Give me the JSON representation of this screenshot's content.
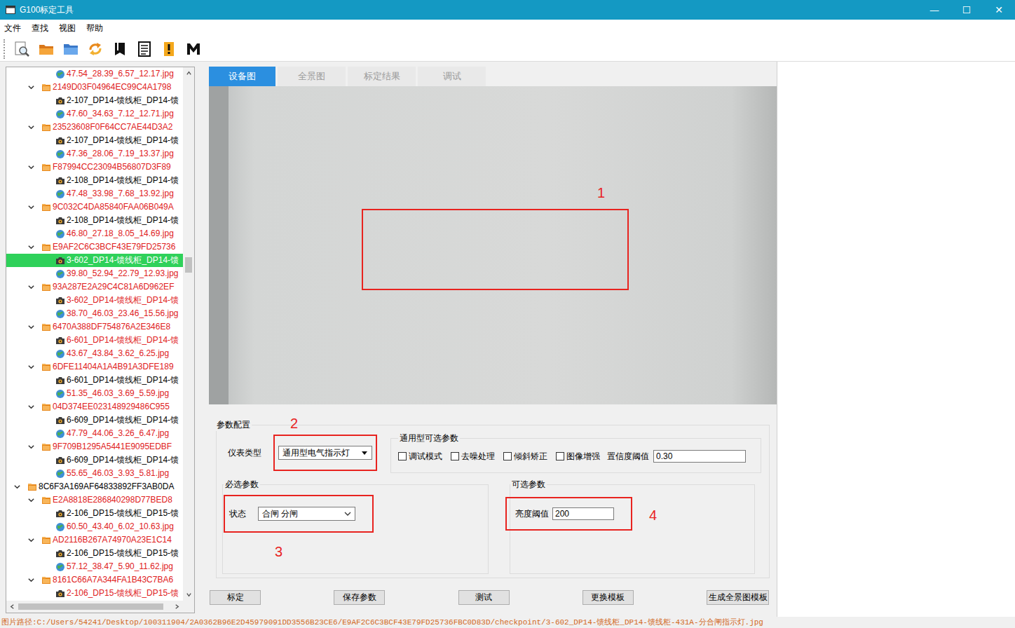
{
  "window": {
    "title": "G100标定工具",
    "controls": [
      "—",
      "☐",
      "✕"
    ]
  },
  "menu": [
    "文件",
    "查找",
    "视图",
    "帮助"
  ],
  "tree": {
    "items": [
      {
        "kind": "globe",
        "level": 2,
        "label": "47.54_28.39_6.57_12.17.jpg",
        "color": "#e0201c",
        "selected": false
      },
      {
        "kind": "folder",
        "level": 1,
        "expanded": true,
        "label": "2149D03F04964EC99C4A1798",
        "color": "#e0201c",
        "selected": false
      },
      {
        "kind": "image",
        "level": 2,
        "label": "2-107_DP14-馈线柜_DP14-馈",
        "color": "#000000",
        "selected": false
      },
      {
        "kind": "globe",
        "level": 2,
        "label": "47.60_34.63_7.12_12.71.jpg",
        "color": "#e0201c",
        "selected": false
      },
      {
        "kind": "folder",
        "level": 1,
        "expanded": true,
        "label": "23523608F0F64CC7AE44D3A2",
        "color": "#e0201c",
        "selected": false
      },
      {
        "kind": "image",
        "level": 2,
        "label": "2-107_DP14-馈线柜_DP14-馈",
        "color": "#000000",
        "selected": false
      },
      {
        "kind": "globe",
        "level": 2,
        "label": "47.36_28.06_7.19_13.37.jpg",
        "color": "#e0201c",
        "selected": false
      },
      {
        "kind": "folder",
        "level": 1,
        "expanded": true,
        "label": "F87994CC23094B56807D3F89",
        "color": "#e0201c",
        "selected": false
      },
      {
        "kind": "image",
        "level": 2,
        "label": "2-108_DP14-馈线柜_DP14-馈",
        "color": "#000000",
        "selected": false
      },
      {
        "kind": "globe",
        "level": 2,
        "label": "47.48_33.98_7.68_13.92.jpg",
        "color": "#e0201c",
        "selected": false
      },
      {
        "kind": "folder",
        "level": 1,
        "expanded": true,
        "label": "9C032C4DA85840FAA06B049A",
        "color": "#e0201c",
        "selected": false
      },
      {
        "kind": "image",
        "level": 2,
        "label": "2-108_DP14-馈线柜_DP14-馈",
        "color": "#000000",
        "selected": false
      },
      {
        "kind": "globe",
        "level": 2,
        "label": "46.80_27.18_8.05_14.69.jpg",
        "color": "#e0201c",
        "selected": false
      },
      {
        "kind": "folder",
        "level": 1,
        "expanded": true,
        "label": "E9AF2C6C3BCF43E79FD25736",
        "color": "#e0201c",
        "selected": false
      },
      {
        "kind": "image",
        "level": 2,
        "label": "3-602_DP14-馈线柜_DP14-馈",
        "color": "#000000",
        "selected": true
      },
      {
        "kind": "globe",
        "level": 2,
        "label": "39.80_52.94_22.79_12.93.jpg",
        "color": "#e0201c",
        "selected": false
      },
      {
        "kind": "folder",
        "level": 1,
        "expanded": true,
        "label": "93A287E2A29C4C81A6D962EF",
        "color": "#e0201c",
        "selected": false
      },
      {
        "kind": "image",
        "level": 2,
        "label": "3-602_DP14-馈线柜_DP14-馈",
        "color": "#e0201c",
        "selected": false
      },
      {
        "kind": "globe",
        "level": 2,
        "label": "38.70_46.03_23.46_15.56.jpg",
        "color": "#e0201c",
        "selected": false
      },
      {
        "kind": "folder",
        "level": 1,
        "expanded": true,
        "label": "6470A388DF754876A2E346E8",
        "color": "#e0201c",
        "selected": false
      },
      {
        "kind": "image",
        "level": 2,
        "label": "6-601_DP14-馈线柜_DP14-馈",
        "color": "#e0201c",
        "selected": false
      },
      {
        "kind": "globe",
        "level": 2,
        "label": "43.67_43.84_3.62_6.25.jpg",
        "color": "#e0201c",
        "selected": false
      },
      {
        "kind": "folder",
        "level": 1,
        "expanded": true,
        "label": "6DFE11404A1A4B91A3DFE189",
        "color": "#e0201c",
        "selected": false
      },
      {
        "kind": "image",
        "level": 2,
        "label": "6-601_DP14-馈线柜_DP14-馈",
        "color": "#000000",
        "selected": false
      },
      {
        "kind": "globe",
        "level": 2,
        "label": "51.35_46.03_3.69_5.59.jpg",
        "color": "#e0201c",
        "selected": false
      },
      {
        "kind": "folder",
        "level": 1,
        "expanded": true,
        "label": "04D374EE023148929486C955",
        "color": "#e0201c",
        "selected": false
      },
      {
        "kind": "image",
        "level": 2,
        "label": "6-609_DP14-馈线柜_DP14-馈",
        "color": "#000000",
        "selected": false
      },
      {
        "kind": "globe",
        "level": 2,
        "label": "47.79_44.06_3.26_6.47.jpg",
        "color": "#e0201c",
        "selected": false
      },
      {
        "kind": "folder",
        "level": 1,
        "expanded": true,
        "label": "9F709B1295A5441E9095EDBF",
        "color": "#e0201c",
        "selected": false
      },
      {
        "kind": "image",
        "level": 2,
        "label": "6-609_DP14-馈线柜_DP14-馈",
        "color": "#000000",
        "selected": false
      },
      {
        "kind": "globe",
        "level": 2,
        "label": "55.65_46.03_3.93_5.81.jpg",
        "color": "#e0201c",
        "selected": false
      },
      {
        "kind": "folder",
        "level": 0,
        "expanded": true,
        "label": "8C6F3A169AF64833892FF3AB0DA",
        "color": "#000000",
        "selected": false
      },
      {
        "kind": "folder",
        "level": 1,
        "expanded": true,
        "label": "E2A8818E286840298D77BED8",
        "color": "#e0201c",
        "selected": false
      },
      {
        "kind": "image",
        "level": 2,
        "label": "2-106_DP15-馈线柜_DP15-馈",
        "color": "#000000",
        "selected": false
      },
      {
        "kind": "globe",
        "level": 2,
        "label": "60.50_43.40_6.02_10.63.jpg",
        "color": "#e0201c",
        "selected": false
      },
      {
        "kind": "folder",
        "level": 1,
        "expanded": true,
        "label": "AD2116B267A74970A23E1C14",
        "color": "#e0201c",
        "selected": false
      },
      {
        "kind": "image",
        "level": 2,
        "label": "2-106_DP15-馈线柜_DP15-馈",
        "color": "#000000",
        "selected": false
      },
      {
        "kind": "globe",
        "level": 2,
        "label": "57.12_38.47_5.90_11.62.jpg",
        "color": "#e0201c",
        "selected": false
      },
      {
        "kind": "folder",
        "level": 1,
        "expanded": true,
        "label": "8161C66A7A344FA1B43C7BA6",
        "color": "#e0201c",
        "selected": false
      },
      {
        "kind": "image",
        "level": 2,
        "label": "2-106_DP15-馈线柜_DP15-馈",
        "color": "#e0201c",
        "selected": false
      }
    ],
    "vertical_scroll": {
      "position": 0.35,
      "size": 0.03
    },
    "horizontal_scroll": {
      "position": 0,
      "size": 0.95
    }
  },
  "tabs": [
    {
      "label": "设备图",
      "selected": true
    },
    {
      "label": "全景图",
      "selected": false
    },
    {
      "label": "标定结果",
      "selected": false
    },
    {
      "label": "调试",
      "selected": false
    }
  ],
  "photo": {
    "annotation": "1"
  },
  "config": {
    "title": "参数配置",
    "meter_type": {
      "label": "仪表类型",
      "value": "通用型电气指示灯",
      "annotation": "2"
    },
    "general_options": {
      "title": "通用型可选参数",
      "checkboxes": [
        {
          "label": "调试模式",
          "checked": false
        },
        {
          "label": "去噪处理",
          "checked": false
        },
        {
          "label": "倾斜矫正",
          "checked": false
        },
        {
          "label": "图像增强",
          "checked": false
        }
      ],
      "confidence": {
        "label": "置信度阈值",
        "value": "0.30"
      }
    },
    "required": {
      "title": "必选参数",
      "state": {
        "label": "状态",
        "value": "合闸 分闸",
        "annotation": "3"
      }
    },
    "optional": {
      "title": "可选参数",
      "brightness": {
        "label": "亮度阈值",
        "value": "200",
        "annotation": "4"
      }
    }
  },
  "buttons": [
    "标定",
    "保存参数",
    "测试",
    "更换模板",
    "生成全景图模板"
  ],
  "status_bar": "图片路径:C:/Users/54241/Desktop/100311904/2A0362B96E2D45979091DD3556B23CE6/E9AF2C6C3BCF43E79FD25736FBC0D83D/checkpoint/3-602_DP14-馈线柜_DP14-馈线柜-431A-分合闸指示灯.jpg"
}
